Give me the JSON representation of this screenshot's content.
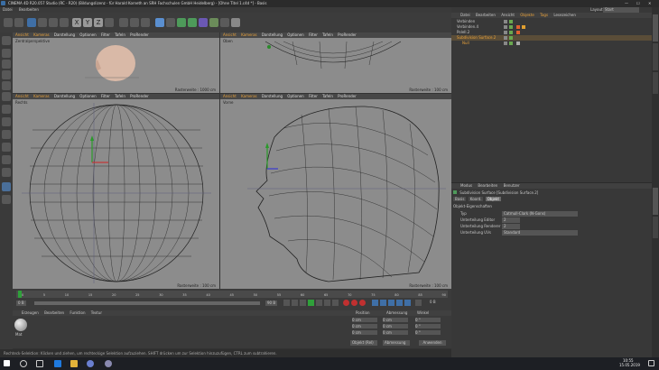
{
  "window": {
    "title": "CINEMA 4D R20.057 Studio (RC - R20) (Bildungslizenz - für Harald Korneth an SRH Fachschulen GmbH Heidelberg) - [Ohne Titel 1.c4d *] - Basis",
    "layout_label": "Layout:",
    "layout_value": "Start",
    "controls": {
      "minimize": "—",
      "maximize": "☐",
      "close": "✕"
    }
  },
  "menu": [
    "Datei",
    "Bearbeiten"
  ],
  "viewports": [
    {
      "menu": [
        "Ansicht",
        "Kameras",
        "Darstellung",
        "Optionen",
        "Filter",
        "Tafeln",
        "ProRender"
      ],
      "label": "Zentralperspektive",
      "footer": ""
    },
    {
      "menu": [
        "Ansicht",
        "Kameras",
        "Darstellung",
        "Optionen",
        "Filter",
        "Tafeln",
        "ProRender"
      ],
      "label": "Oben",
      "footer": "Rasterweite : 100 cm"
    },
    {
      "menu": [
        "Ansicht",
        "Kameras",
        "Darstellung",
        "Optionen",
        "Filter",
        "Tafeln",
        "ProRender"
      ],
      "label": "Rechts",
      "footer": "Rasterweite : 100 cm"
    },
    {
      "menu": [
        "Ansicht",
        "Kameras",
        "Darstellung",
        "Optionen",
        "Filter",
        "Tafeln",
        "ProRender"
      ],
      "label": "Vorne",
      "footer": "Rasterweite : 100 cm"
    }
  ],
  "viewport1_footer": "Rasterweite : 1000 cm",
  "objects_panel": {
    "tabs": [
      "Datei",
      "Bearbeiten",
      "Ansicht",
      "Objekte",
      "Tags",
      "Lesezeichen"
    ],
    "items": [
      "Verbinden",
      "Verbinden.4",
      "Polell.2",
      "Subdivision Surface.2",
      "Null"
    ]
  },
  "attributes_panel": {
    "tabs": [
      "Modus",
      "Bearbeiten",
      "Benutzer"
    ],
    "object_title": "Subdivision Surface [Subdivision Surface.2]",
    "subtabs": [
      "Basis",
      "Koord.",
      "Objekt"
    ],
    "section": "Objekt-Eigenschaften",
    "rows": [
      {
        "label": "Typ",
        "value": "Catmull-Clark (N-Gons)"
      },
      {
        "label": "Unterteilung Editor",
        "value": "2"
      },
      {
        "label": "Unterteilung Renderer",
        "value": "2"
      },
      {
        "label": "Unterteilung UVs",
        "value": "Standard"
      }
    ]
  },
  "timeline": {
    "ticks": [
      "0",
      "5",
      "10",
      "15",
      "20",
      "25",
      "30",
      "35",
      "40",
      "45",
      "50",
      "55",
      "60",
      "65",
      "70",
      "75",
      "80",
      "85",
      "90"
    ],
    "start": "0 B",
    "end": "90 B",
    "current": "0 B",
    "frame_badge": "0 B"
  },
  "material_panel": {
    "tabs": [
      "Erzeugen",
      "Bearbeiten",
      "Funktion",
      "Textur"
    ],
    "material_name": "Mat"
  },
  "coords_panel": {
    "headers": [
      "Position",
      "Abmessung",
      "Winkel"
    ],
    "rows": [
      [
        "0 cm",
        "0 cm",
        "0 °"
      ],
      [
        "0 cm",
        "0 cm",
        "0 °"
      ],
      [
        "0 cm",
        "0 cm",
        "0 °"
      ]
    ],
    "dropdown1": "Objekt (Rel)",
    "dropdown2": "Abmessung",
    "apply": "Anwenden"
  },
  "status_text": "Rechteck-Selektion: Klicken und ziehen, um rechteckige Selektion aufzuziehen. SHIFT drücken um zur Selektion hinzuzufügen, CTRL zum subtrahieren.",
  "taskbar": {
    "time": "10:55",
    "date": "15.05.2019"
  },
  "colors": {
    "accent": "#e9a23b",
    "viewport_bg": "#8c8c8c",
    "panel_bg": "#383838"
  }
}
